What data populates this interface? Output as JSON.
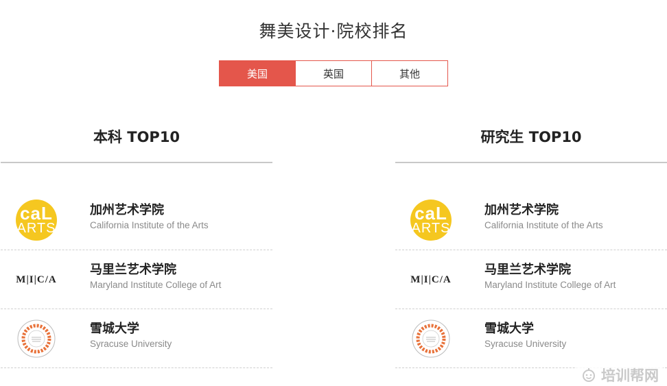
{
  "header": {
    "title": "舞美设计·院校排名"
  },
  "tabs": [
    {
      "label": "美国",
      "active": true
    },
    {
      "label": "英国",
      "active": false
    },
    {
      "label": "其他",
      "active": false
    }
  ],
  "undergrad": {
    "title": "本科 TOP10",
    "schools": [
      {
        "name_cn": "加州艺术学院",
        "name_en": "California Institute of the Arts",
        "logo": "calarts-logo",
        "logo_text_1": "caL",
        "logo_text_2": "ARTS"
      },
      {
        "name_cn": "马里兰艺术学院",
        "name_en": "Maryland Institute College of Art",
        "logo": "mica-logo",
        "logo_text": "M|I|C/A"
      },
      {
        "name_cn": "雪城大学",
        "name_en": "Syracuse University",
        "logo": "syracuse-seal-logo"
      }
    ]
  },
  "graduate": {
    "title": "研究生 TOP10",
    "schools": [
      {
        "name_cn": "加州艺术学院",
        "name_en": "California Institute of the Arts",
        "logo": "calarts-logo",
        "logo_text_1": "caL",
        "logo_text_2": "ARTS"
      },
      {
        "name_cn": "马里兰艺术学院",
        "name_en": "Maryland Institute College of Art",
        "logo": "mica-logo",
        "logo_text": "M|I|C/A"
      },
      {
        "name_cn": "雪城大学",
        "name_en": "Syracuse University",
        "logo": "syracuse-seal-logo"
      }
    ]
  },
  "watermark": {
    "text": "培训帮网"
  },
  "colors": {
    "accent": "#e4564b",
    "calarts_yellow": "#f5c720",
    "seal_orange": "#e8723a"
  }
}
